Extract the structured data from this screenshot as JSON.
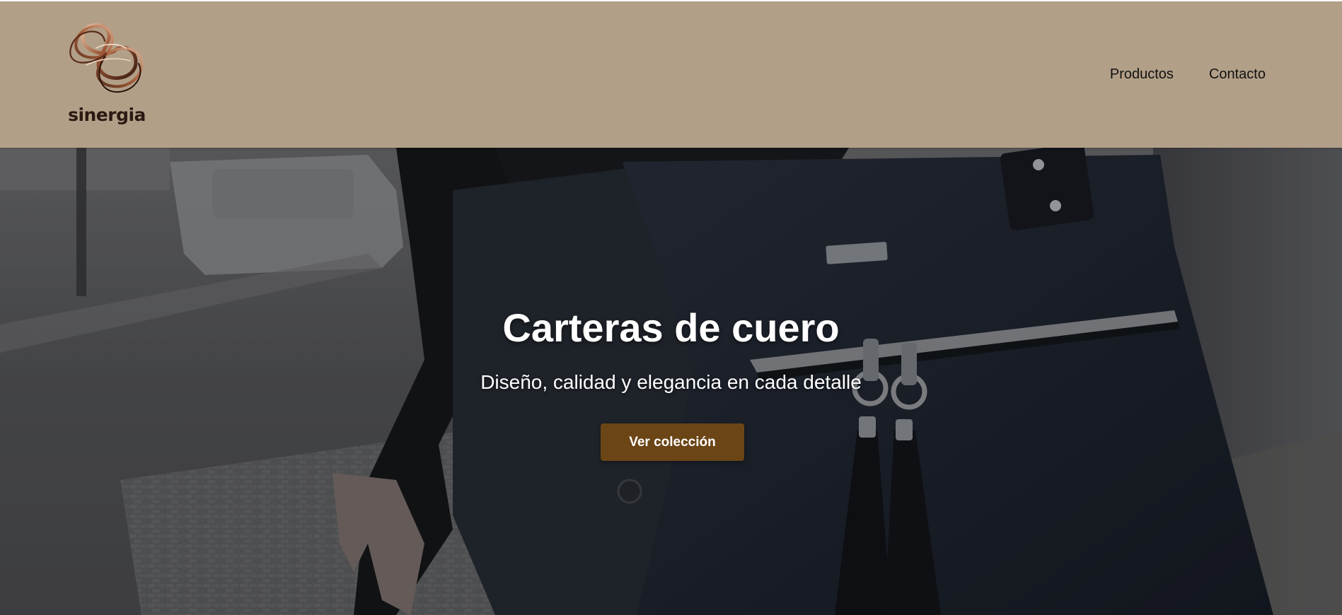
{
  "brand": {
    "name": "sinergia",
    "logo_icon": "infinity-knot-icon",
    "header_color": "#b29f88",
    "wordmark_color": "#2a1a12"
  },
  "nav": {
    "items": [
      {
        "label": "Productos"
      },
      {
        "label": "Contacto"
      }
    ]
  },
  "hero": {
    "title": "Carteras de cuero",
    "subtitle": "Diseño, calidad y elegancia en cada detalle",
    "cta_label": "Ver colección",
    "cta_color": "#6b4516",
    "background_image": "photo-dark-leather-handbag-street"
  }
}
